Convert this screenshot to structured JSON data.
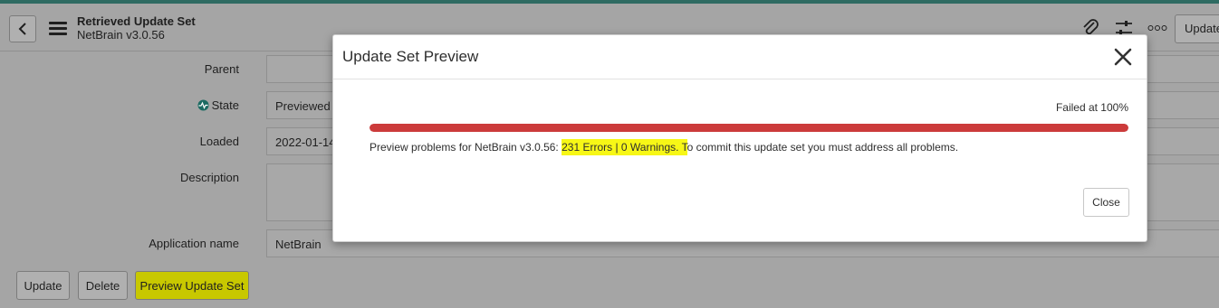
{
  "header": {
    "title": "Retrieved Update Set",
    "subtitle": "NetBrain v3.0.56",
    "update_label": "Update",
    "icons": [
      "back-icon",
      "menu-icon",
      "paperclip-icon",
      "sliders-icon",
      "more-icon"
    ]
  },
  "form": {
    "parent": {
      "label": "Parent",
      "value": ""
    },
    "state": {
      "label": "State",
      "value": "Previewed",
      "icon": "state-icon"
    },
    "loaded": {
      "label": "Loaded",
      "value": "2022-01-14"
    },
    "description": {
      "label": "Description",
      "value": ""
    },
    "application_name": {
      "label": "Application name",
      "value": "NetBrain"
    }
  },
  "buttons": {
    "update": "Update",
    "delete": "Delete",
    "preview": "Preview Update Set"
  },
  "modal": {
    "title": "Update Set Preview",
    "status": "Failed at 100%",
    "progress_percent": 100,
    "progress_color": "#cc3b3b",
    "message_prefix": "Preview problems for NetBrain v3.0.56: ",
    "message_highlight": "231 Errors | 0 Warnings. T",
    "message_suffix": "o commit this update set you must address all problems.",
    "close_label": "Close"
  },
  "colors": {
    "highlight": "#f7f716",
    "accent_bar": "#2f6b62"
  }
}
